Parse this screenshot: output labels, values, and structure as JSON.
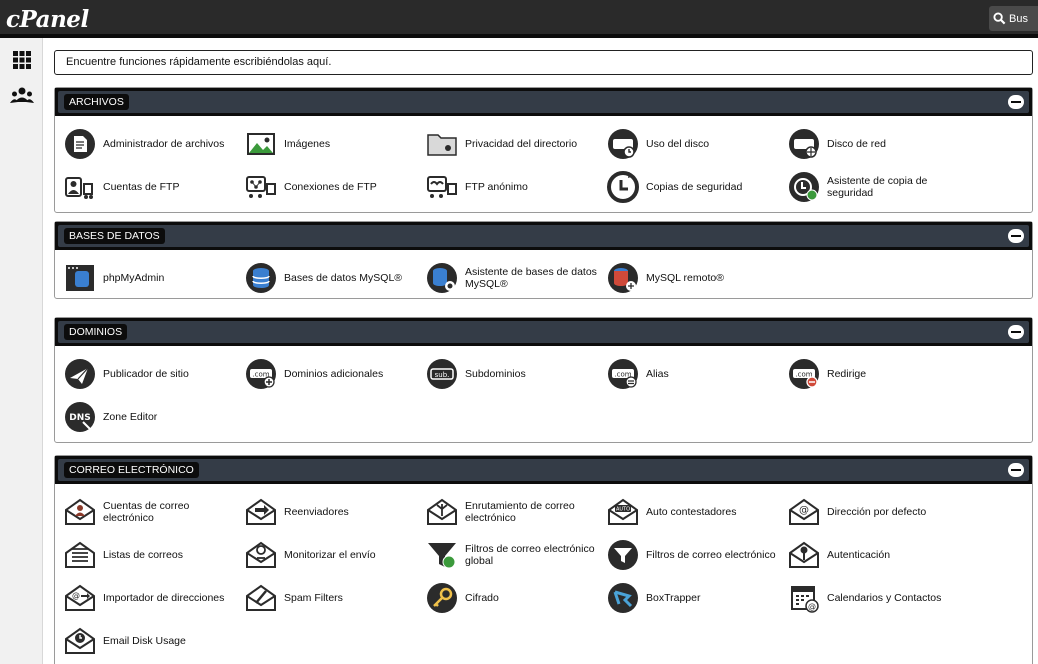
{
  "app": {
    "logo": "cPanel",
    "search_label": "Bus"
  },
  "search": {
    "placeholder": "Encuentre funciones rápidamente escribiéndolas aquí."
  },
  "sections": [
    {
      "title": "ARCHIVOS",
      "items": [
        {
          "label": "Administrador de archivos",
          "icon": "file-manager-icon"
        },
        {
          "label": "Imágenes",
          "icon": "images-icon"
        },
        {
          "label": "Privacidad del directorio",
          "icon": "folder-lock-icon"
        },
        {
          "label": "Uso del disco",
          "icon": "disk-usage-icon"
        },
        {
          "label": "Disco de red",
          "icon": "network-disk-icon"
        },
        {
          "label": "Cuentas de FTP",
          "icon": "ftp-accounts-icon"
        },
        {
          "label": "Conexiones de FTP",
          "icon": "ftp-connections-icon"
        },
        {
          "label": "FTP anónimo",
          "icon": "anonymous-ftp-icon"
        },
        {
          "label": "Copias de seguridad",
          "icon": "backup-icon"
        },
        {
          "label": "Asistente de copia de seguridad",
          "icon": "backup-wizard-icon"
        }
      ]
    },
    {
      "title": "BASES DE DATOS",
      "items": [
        {
          "label": "phpMyAdmin",
          "icon": "phpmyadmin-icon"
        },
        {
          "label": "Bases de datos MySQL®",
          "icon": "database-icon"
        },
        {
          "label": "Asistente de bases de datos MySQL®",
          "icon": "database-wizard-icon"
        },
        {
          "label": "MySQL remoto®",
          "icon": "remote-database-icon"
        }
      ]
    },
    {
      "title": "DOMINIOS",
      "items": [
        {
          "label": "Publicador de sitio",
          "icon": "site-publisher-icon"
        },
        {
          "label": "Dominios adicionales",
          "icon": "addon-domains-icon"
        },
        {
          "label": "Subdominios",
          "icon": "subdomains-icon"
        },
        {
          "label": "Alias",
          "icon": "aliases-icon"
        },
        {
          "label": "Redirige",
          "icon": "redirects-icon"
        },
        {
          "label": "Zone Editor",
          "icon": "dns-zone-icon"
        }
      ]
    },
    {
      "title": "CORREO ELECTRÓNICO",
      "items": [
        {
          "label": "Cuentas de correo electrónico",
          "icon": "email-accounts-icon"
        },
        {
          "label": "Reenviadores",
          "icon": "forwarders-icon"
        },
        {
          "label": "Enrutamiento de correo electrónico",
          "icon": "email-routing-icon"
        },
        {
          "label": "Auto contestadores",
          "icon": "autoresponders-icon"
        },
        {
          "label": "Dirección por defecto",
          "icon": "default-address-icon"
        },
        {
          "label": "Listas de correos",
          "icon": "mailing-lists-icon"
        },
        {
          "label": "Monitorizar el envío",
          "icon": "track-delivery-icon"
        },
        {
          "label": "Filtros de correo electrónico global",
          "icon": "global-filter-icon"
        },
        {
          "label": "Filtros de correo electrónico",
          "icon": "email-filter-icon"
        },
        {
          "label": "Autenticación",
          "icon": "authentication-icon"
        },
        {
          "label": "Importador de direcciones",
          "icon": "address-importer-icon"
        },
        {
          "label": "Spam Filters",
          "icon": "spam-filter-icon"
        },
        {
          "label": "Cifrado",
          "icon": "encryption-icon"
        },
        {
          "label": "BoxTrapper",
          "icon": "boxtrapper-icon"
        },
        {
          "label": "Calendarios y Contactos",
          "icon": "calendar-contacts-icon"
        },
        {
          "label": "Email Disk Usage",
          "icon": "email-disk-usage-icon"
        }
      ]
    }
  ],
  "colors": {
    "topbar": "#2a2a2a",
    "section_header": "#343c47",
    "icon": "#2b2b2b"
  }
}
